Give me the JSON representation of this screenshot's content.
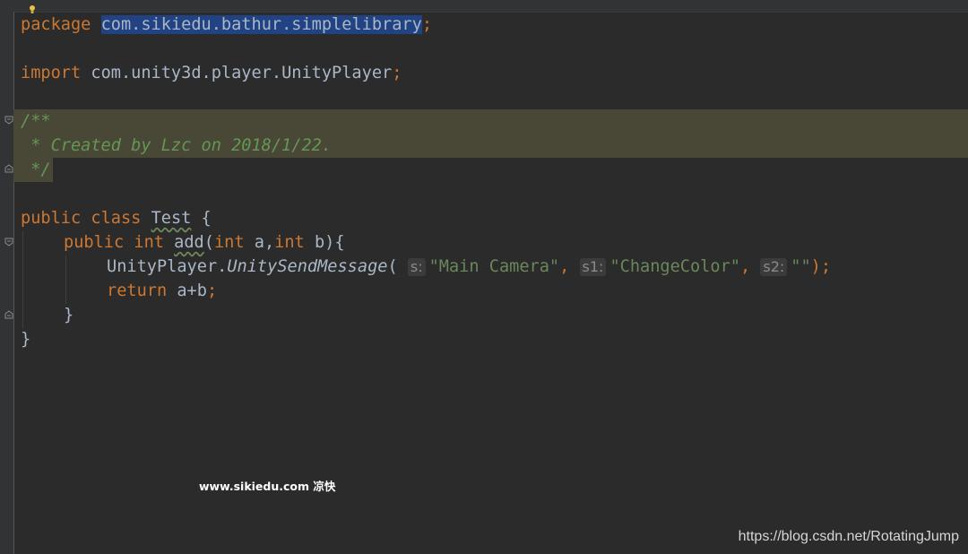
{
  "editor": {
    "lines": {
      "package_kw": "package",
      "package_name": "com.sikiedu.bathur.simplelibrary",
      "package_semi": ";",
      "import_kw": "import",
      "import_name": "com.unity3d.player.UnityPlayer",
      "import_semi": ";",
      "doc_open": "/**",
      "doc_body": " * Created by Lzc on 2018/1/22.",
      "doc_close": " */",
      "class_public": "public",
      "class_kw": "class",
      "class_name": "Test",
      "class_brace": " {",
      "method_public": "public",
      "method_int": "int",
      "method_name": "add",
      "method_paren_open": "(",
      "param_int_a": "int",
      "param_a": " a,",
      "param_int_b": "int",
      "param_b": " b){",
      "call_class": "UnityPlayer.",
      "call_method": "UnitySendMessage",
      "call_paren": "( ",
      "hint_s": "s:",
      "arg1": "\"Main Camera\"",
      "comma1": ",",
      "hint_s1": "s1:",
      "arg2": "\"ChangeColor\"",
      "comma2": ",",
      "hint_s2": "s2:",
      "arg3": "\"\"",
      "call_end": ");",
      "return_kw": "return",
      "return_expr": " a+b",
      "return_semi": ";",
      "method_close": "}",
      "class_close": "}"
    }
  },
  "watermarks": {
    "center": "www.sikiedu.com 凉快",
    "corner": "https://blog.csdn.net/RotatingJump"
  },
  "icons": {
    "bulb": "lightbulb-icon",
    "fold": "fold-marker-icon"
  },
  "colors": {
    "background": "#2b2b2b",
    "keyword": "#cc7832",
    "doc_comment": "#629755",
    "string": "#6a8759",
    "selection": "#214283",
    "doc_highlight": "#494836"
  }
}
